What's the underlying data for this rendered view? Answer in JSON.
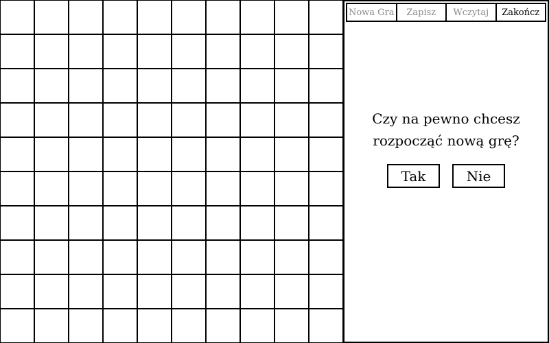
{
  "board": {
    "rows": 10,
    "cols": 10
  },
  "menu": {
    "new_game": "Nowa Gra",
    "save": "Zapisz",
    "load": "Wczytaj",
    "quit": "Zakończ"
  },
  "dialog": {
    "line1": "Czy na pewno chcesz",
    "line2": "rozpocząć nową grę?",
    "yes": "Tak",
    "no": "Nie"
  },
  "colors": {
    "inactive_menu_text": "#8a8a8a",
    "active_menu_text": "#000000"
  }
}
